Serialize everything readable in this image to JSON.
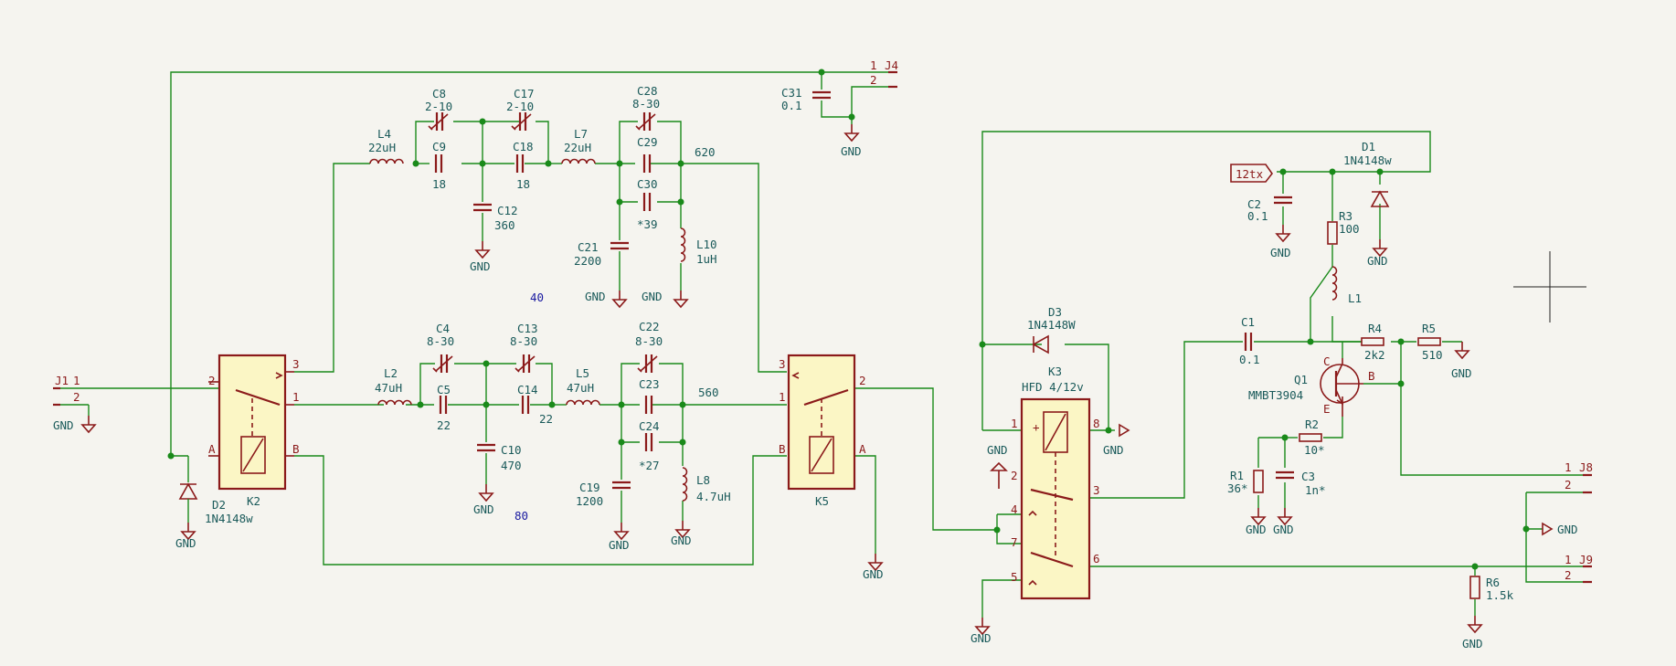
{
  "connectors": {
    "j1": {
      "ref": "J1",
      "pins": [
        "1",
        "2"
      ]
    },
    "j4": {
      "ref": "J4",
      "pins": [
        "1",
        "2"
      ]
    },
    "j8": {
      "ref": "J8",
      "pins": [
        "1",
        "2"
      ]
    },
    "j9": {
      "ref": "J9",
      "pins": [
        "1",
        "2"
      ]
    }
  },
  "gnd_label": "GND",
  "net_labels": {
    "v12tx": "12tx",
    "net620": "620",
    "net560": "560",
    "net40": "40",
    "net80": "80"
  },
  "relays": {
    "k2": {
      "ref": "K2",
      "pins": [
        "2",
        "3",
        "1",
        "A",
        "B"
      ]
    },
    "k5": {
      "ref": "K5",
      "pins": [
        "3",
        "1",
        "2",
        "B",
        "A"
      ]
    },
    "k3": {
      "ref": "K3",
      "value": "HFD 4/12v",
      "pins": [
        "1",
        "2",
        "4",
        "7",
        "5",
        "8",
        "3",
        "6"
      ]
    }
  },
  "filter40": {
    "l4": {
      "ref": "L4",
      "value": "22uH"
    },
    "c8": {
      "ref": "C8",
      "value": "2-10"
    },
    "c9": {
      "ref": "C9",
      "value": "18"
    },
    "c17": {
      "ref": "C17",
      "value": "2-10"
    },
    "c18": {
      "ref": "C18",
      "value": "18"
    },
    "c12": {
      "ref": "C12",
      "value": "360"
    },
    "l7": {
      "ref": "L7",
      "value": "22uH"
    },
    "c28": {
      "ref": "C28",
      "value": "8-30"
    },
    "c29": {
      "ref": "C29",
      "value": ""
    },
    "c30": {
      "ref": "C30",
      "value": "*39"
    },
    "c21": {
      "ref": "C21",
      "value": "2200"
    },
    "l10": {
      "ref": "L10",
      "value": "1uH"
    },
    "c31": {
      "ref": "C31",
      "value": "0.1"
    }
  },
  "filter80": {
    "l2": {
      "ref": "L2",
      "value": "47uH"
    },
    "c4": {
      "ref": "C4",
      "value": "8-30"
    },
    "c5": {
      "ref": "C5",
      "value": "22"
    },
    "c13": {
      "ref": "C13",
      "value": "8-30"
    },
    "c14": {
      "ref": "C14",
      "value": "22"
    },
    "c10": {
      "ref": "C10",
      "value": "470"
    },
    "l5": {
      "ref": "L5",
      "value": "47uH"
    },
    "c22": {
      "ref": "C22",
      "value": "8-30"
    },
    "c23": {
      "ref": "C23",
      "value": ""
    },
    "c24": {
      "ref": "C24",
      "value": "*27"
    },
    "c19": {
      "ref": "C19",
      "value": "1200"
    },
    "l8": {
      "ref": "L8",
      "value": "4.7uH"
    }
  },
  "diodes": {
    "d2": {
      "ref": "D2",
      "value": "1N4148w"
    },
    "d3": {
      "ref": "D3",
      "value": "1N4148W"
    },
    "d1": {
      "ref": "D1",
      "value": "1N4148w"
    }
  },
  "amp": {
    "c2": {
      "ref": "C2",
      "value": "0.1"
    },
    "r3": {
      "ref": "R3",
      "value": "100"
    },
    "l1": {
      "ref": "L1",
      "value": ""
    },
    "c1": {
      "ref": "C1",
      "value": "0.1"
    },
    "r4": {
      "ref": "R4",
      "value": "2k2"
    },
    "r5": {
      "ref": "R5",
      "value": "510"
    },
    "q1": {
      "ref": "Q1",
      "value": "MMBT3904",
      "pins": [
        "C",
        "B",
        "E"
      ]
    },
    "r2": {
      "ref": "R2",
      "value": "10*"
    },
    "r1": {
      "ref": "R1",
      "value": "36*"
    },
    "c3": {
      "ref": "C3",
      "value": "1n*"
    },
    "r6": {
      "ref": "R6",
      "value": "1.5k"
    }
  }
}
